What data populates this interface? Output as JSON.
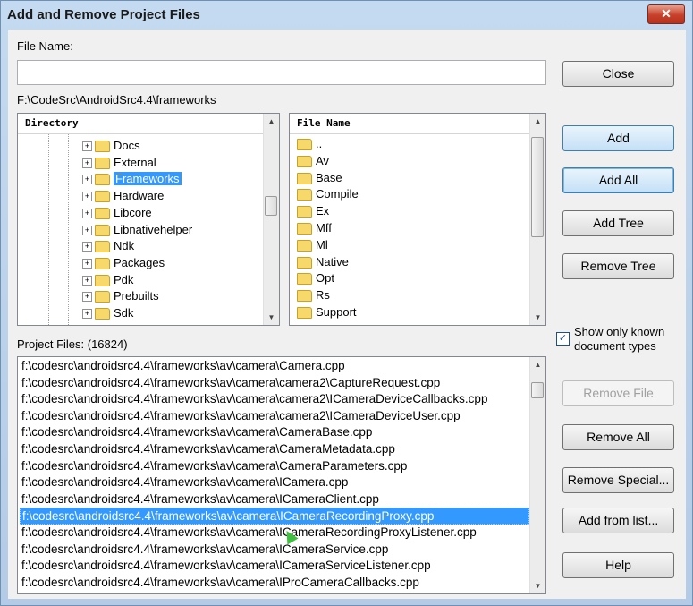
{
  "window": {
    "title": "Add and Remove Project Files",
    "close_glyph": "✕"
  },
  "file_name": {
    "label": "File Name:",
    "value": ""
  },
  "current_path": "F:\\CodeSrc\\AndroidSrc4.4\\frameworks",
  "directory": {
    "header": "Directory",
    "items": [
      "Docs",
      "External",
      "Frameworks",
      "Hardware",
      "Libcore",
      "Libnativehelper",
      "Ndk",
      "Packages",
      "Pdk",
      "Prebuilts",
      "Sdk"
    ],
    "selected": "Frameworks"
  },
  "files": {
    "header": "File Name",
    "items": [
      "..",
      "Av",
      "Base",
      "Compile",
      "Ex",
      "Mff",
      "Ml",
      "Native",
      "Opt",
      "Rs",
      "Support"
    ]
  },
  "buttons": {
    "close": "Close",
    "add": "Add",
    "add_all": "Add All",
    "add_tree": "Add Tree",
    "remove_tree": "Remove Tree",
    "remove_file": "Remove File",
    "remove_all": "Remove All",
    "remove_special": "Remove Special...",
    "add_from_list": "Add from list...",
    "help": "Help"
  },
  "show_known": {
    "label_line1": "Show only known",
    "label_line2": "document types",
    "checked": true,
    "check_glyph": "✓"
  },
  "project_files": {
    "label": "Project Files: (16824)",
    "items": [
      "f:\\codesrc\\androidsrc4.4\\frameworks\\av\\camera\\Camera.cpp",
      "f:\\codesrc\\androidsrc4.4\\frameworks\\av\\camera\\camera2\\CaptureRequest.cpp",
      "f:\\codesrc\\androidsrc4.4\\frameworks\\av\\camera\\camera2\\ICameraDeviceCallbacks.cpp",
      "f:\\codesrc\\androidsrc4.4\\frameworks\\av\\camera\\camera2\\ICameraDeviceUser.cpp",
      "f:\\codesrc\\androidsrc4.4\\frameworks\\av\\camera\\CameraBase.cpp",
      "f:\\codesrc\\androidsrc4.4\\frameworks\\av\\camera\\CameraMetadata.cpp",
      "f:\\codesrc\\androidsrc4.4\\frameworks\\av\\camera\\CameraParameters.cpp",
      "f:\\codesrc\\androidsrc4.4\\frameworks\\av\\camera\\ICamera.cpp",
      "f:\\codesrc\\androidsrc4.4\\frameworks\\av\\camera\\ICameraClient.cpp",
      "f:\\codesrc\\androidsrc4.4\\frameworks\\av\\camera\\ICameraRecordingProxy.cpp",
      "f:\\codesrc\\androidsrc4.4\\frameworks\\av\\camera\\ICameraRecordingProxyListener.cpp",
      "f:\\codesrc\\androidsrc4.4\\frameworks\\av\\camera\\ICameraService.cpp",
      "f:\\codesrc\\androidsrc4.4\\frameworks\\av\\camera\\ICameraServiceListener.cpp",
      "f:\\codesrc\\androidsrc4.4\\frameworks\\av\\camera\\IProCameraCallbacks.cpp"
    ],
    "selected_index": 9
  },
  "icons": {
    "folder": "folder-icon",
    "expand": "plus-expander-icon",
    "scroll_up": "scroll-up-arrow-icon",
    "scroll_down": "scroll-down-arrow-icon"
  },
  "colors": {
    "selection": "#3399ff",
    "title_close": "#c7402a",
    "folder": "#f7d86a"
  }
}
